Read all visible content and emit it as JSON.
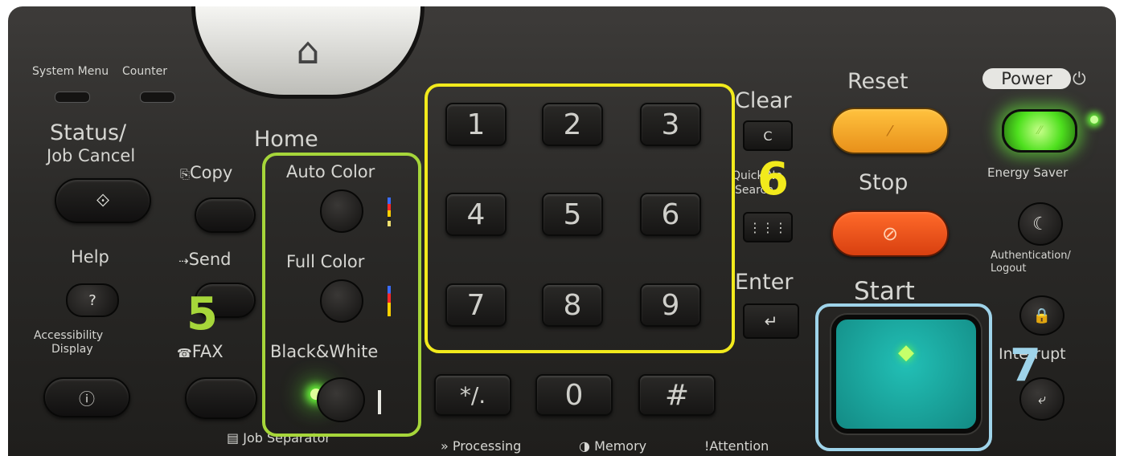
{
  "left": {
    "system_menu": "System Menu",
    "counter": "Counter",
    "status_line1": "Status/",
    "status_line2": "Job Cancel",
    "help": "Help",
    "help_key": "?",
    "accessibility_line1": "Accessibility",
    "accessibility_line2": "Display"
  },
  "home": {
    "label": "Home"
  },
  "functions": {
    "copy": "Copy",
    "send": "Send",
    "fax": "FAX",
    "job_separator": "Job Separator"
  },
  "color_modes": {
    "auto": "Auto Color",
    "full": "Full Color",
    "bw": "Black&White"
  },
  "keypad": {
    "keys": [
      "1",
      "2",
      "3",
      "4",
      "5",
      "6",
      "7",
      "8",
      "9"
    ],
    "star": "*/.",
    "zero": "0",
    "hash": "#"
  },
  "center": {
    "clear": "Clear",
    "clear_key": "C",
    "quick_line1": "Quick No.",
    "quick_line2": "Search",
    "enter": "Enter"
  },
  "indicators": {
    "processing": "Processing",
    "memory": "Memory",
    "attention": "Attention"
  },
  "right": {
    "reset": "Reset",
    "stop": "Stop",
    "start": "Start",
    "power": "Power",
    "energy_saver": "Energy Saver",
    "auth_line1": "Authentication/",
    "auth_line2": "Logout",
    "interrupt": "Interrupt"
  },
  "annotations": {
    "five": "5",
    "six": "6",
    "seven": "7"
  },
  "colors": {
    "annotation_green": "#a6d63a",
    "annotation_yellow": "#f2ea1c",
    "annotation_blue": "#9fd4ea",
    "reset_orange": "#f0a81e",
    "stop_red": "#e8501a",
    "start_teal": "#1aa6a0",
    "led_green": "#6bff3a"
  }
}
